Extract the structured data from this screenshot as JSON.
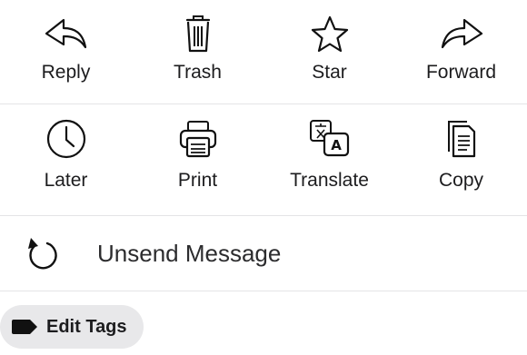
{
  "actions_row1": [
    {
      "label": "Reply",
      "icon": "reply-icon"
    },
    {
      "label": "Trash",
      "icon": "trash-icon"
    },
    {
      "label": "Star",
      "icon": "star-icon"
    },
    {
      "label": "Forward",
      "icon": "forward-icon"
    }
  ],
  "actions_row2": [
    {
      "label": "Later",
      "icon": "clock-icon"
    },
    {
      "label": "Print",
      "icon": "printer-icon"
    },
    {
      "label": "Translate",
      "icon": "translate-icon"
    },
    {
      "label": "Copy",
      "icon": "copy-icon"
    }
  ],
  "unsend": {
    "label": "Unsend Message",
    "icon": "undo-icon"
  },
  "tags": {
    "label": "Edit Tags",
    "icon": "tag-icon"
  },
  "colors": {
    "text": "#1c1c1e",
    "divider": "#e4e4e6",
    "chip": "#e8e8ea"
  }
}
